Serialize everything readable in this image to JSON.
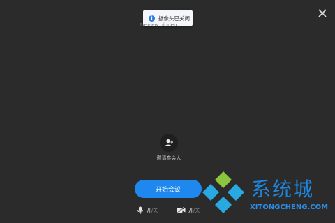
{
  "toast": {
    "message": "摄像头已关闭",
    "icon": "info-icon"
  },
  "background_text": "Preview hidden",
  "invite": {
    "label": "邀请参会人",
    "icon": "add-user-icon"
  },
  "start_button": {
    "label": "开始会议"
  },
  "mic_control": {
    "on_label": "开",
    "separator": "/",
    "off_label": "关",
    "icon": "microphone-icon"
  },
  "camera_control": {
    "on_label": "开",
    "separator": "/",
    "off_label": "关",
    "icon": "camera-off-icon"
  },
  "watermark": {
    "cn_text": "系统城",
    "en_text": "XITONGCHENG.COM"
  },
  "colors": {
    "background": "#2b2b2b",
    "accent": "#1f88ef",
    "toast_bg": "#f4f6fa"
  }
}
